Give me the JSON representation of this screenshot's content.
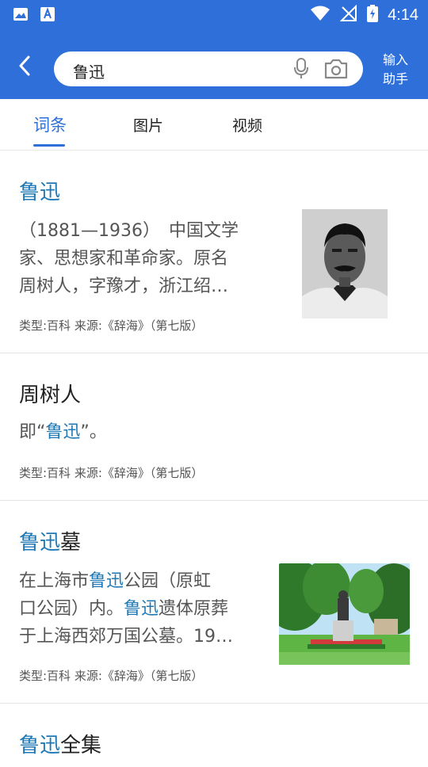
{
  "status_bar": {
    "time": "4:14"
  },
  "header": {
    "search_query": "鲁迅",
    "assist_line1": "输入",
    "assist_line2": "助手"
  },
  "tabs": [
    {
      "label": "词条"
    },
    {
      "label": "图片"
    },
    {
      "label": "视频"
    }
  ],
  "entries": [
    {
      "title_hl": "鲁迅",
      "title_rest": "",
      "desc_l1": "（1881—1936）　中国文学",
      "desc_l2": "家、思想家和革命家。原名",
      "desc_l3": "周树人，字豫才，浙江绍…",
      "meta": "类型:百科  来源:《辞海》（第七版）"
    },
    {
      "title_plain": "周树人",
      "desc_pre": "即“",
      "desc_hl": "鲁迅",
      "desc_post": "”。",
      "meta": "类型:百科  来源:《辞海》（第七版）"
    },
    {
      "title_hl": "鲁迅",
      "title_rest": "墓",
      "desc_l1_pre": "在上海市",
      "desc_l1_hl": "鲁迅",
      "desc_l1_post": "公园（原虹",
      "desc_l2_pre": "口公园）内。",
      "desc_l2_hl": "鲁迅",
      "desc_l2_post": "遗体原葬",
      "desc_l3": "于上海西郊万国公墓。19…",
      "meta": "类型:百科  来源:《辞海》（第七版）"
    },
    {
      "title_hl": "鲁迅",
      "title_rest": "全集"
    }
  ]
}
